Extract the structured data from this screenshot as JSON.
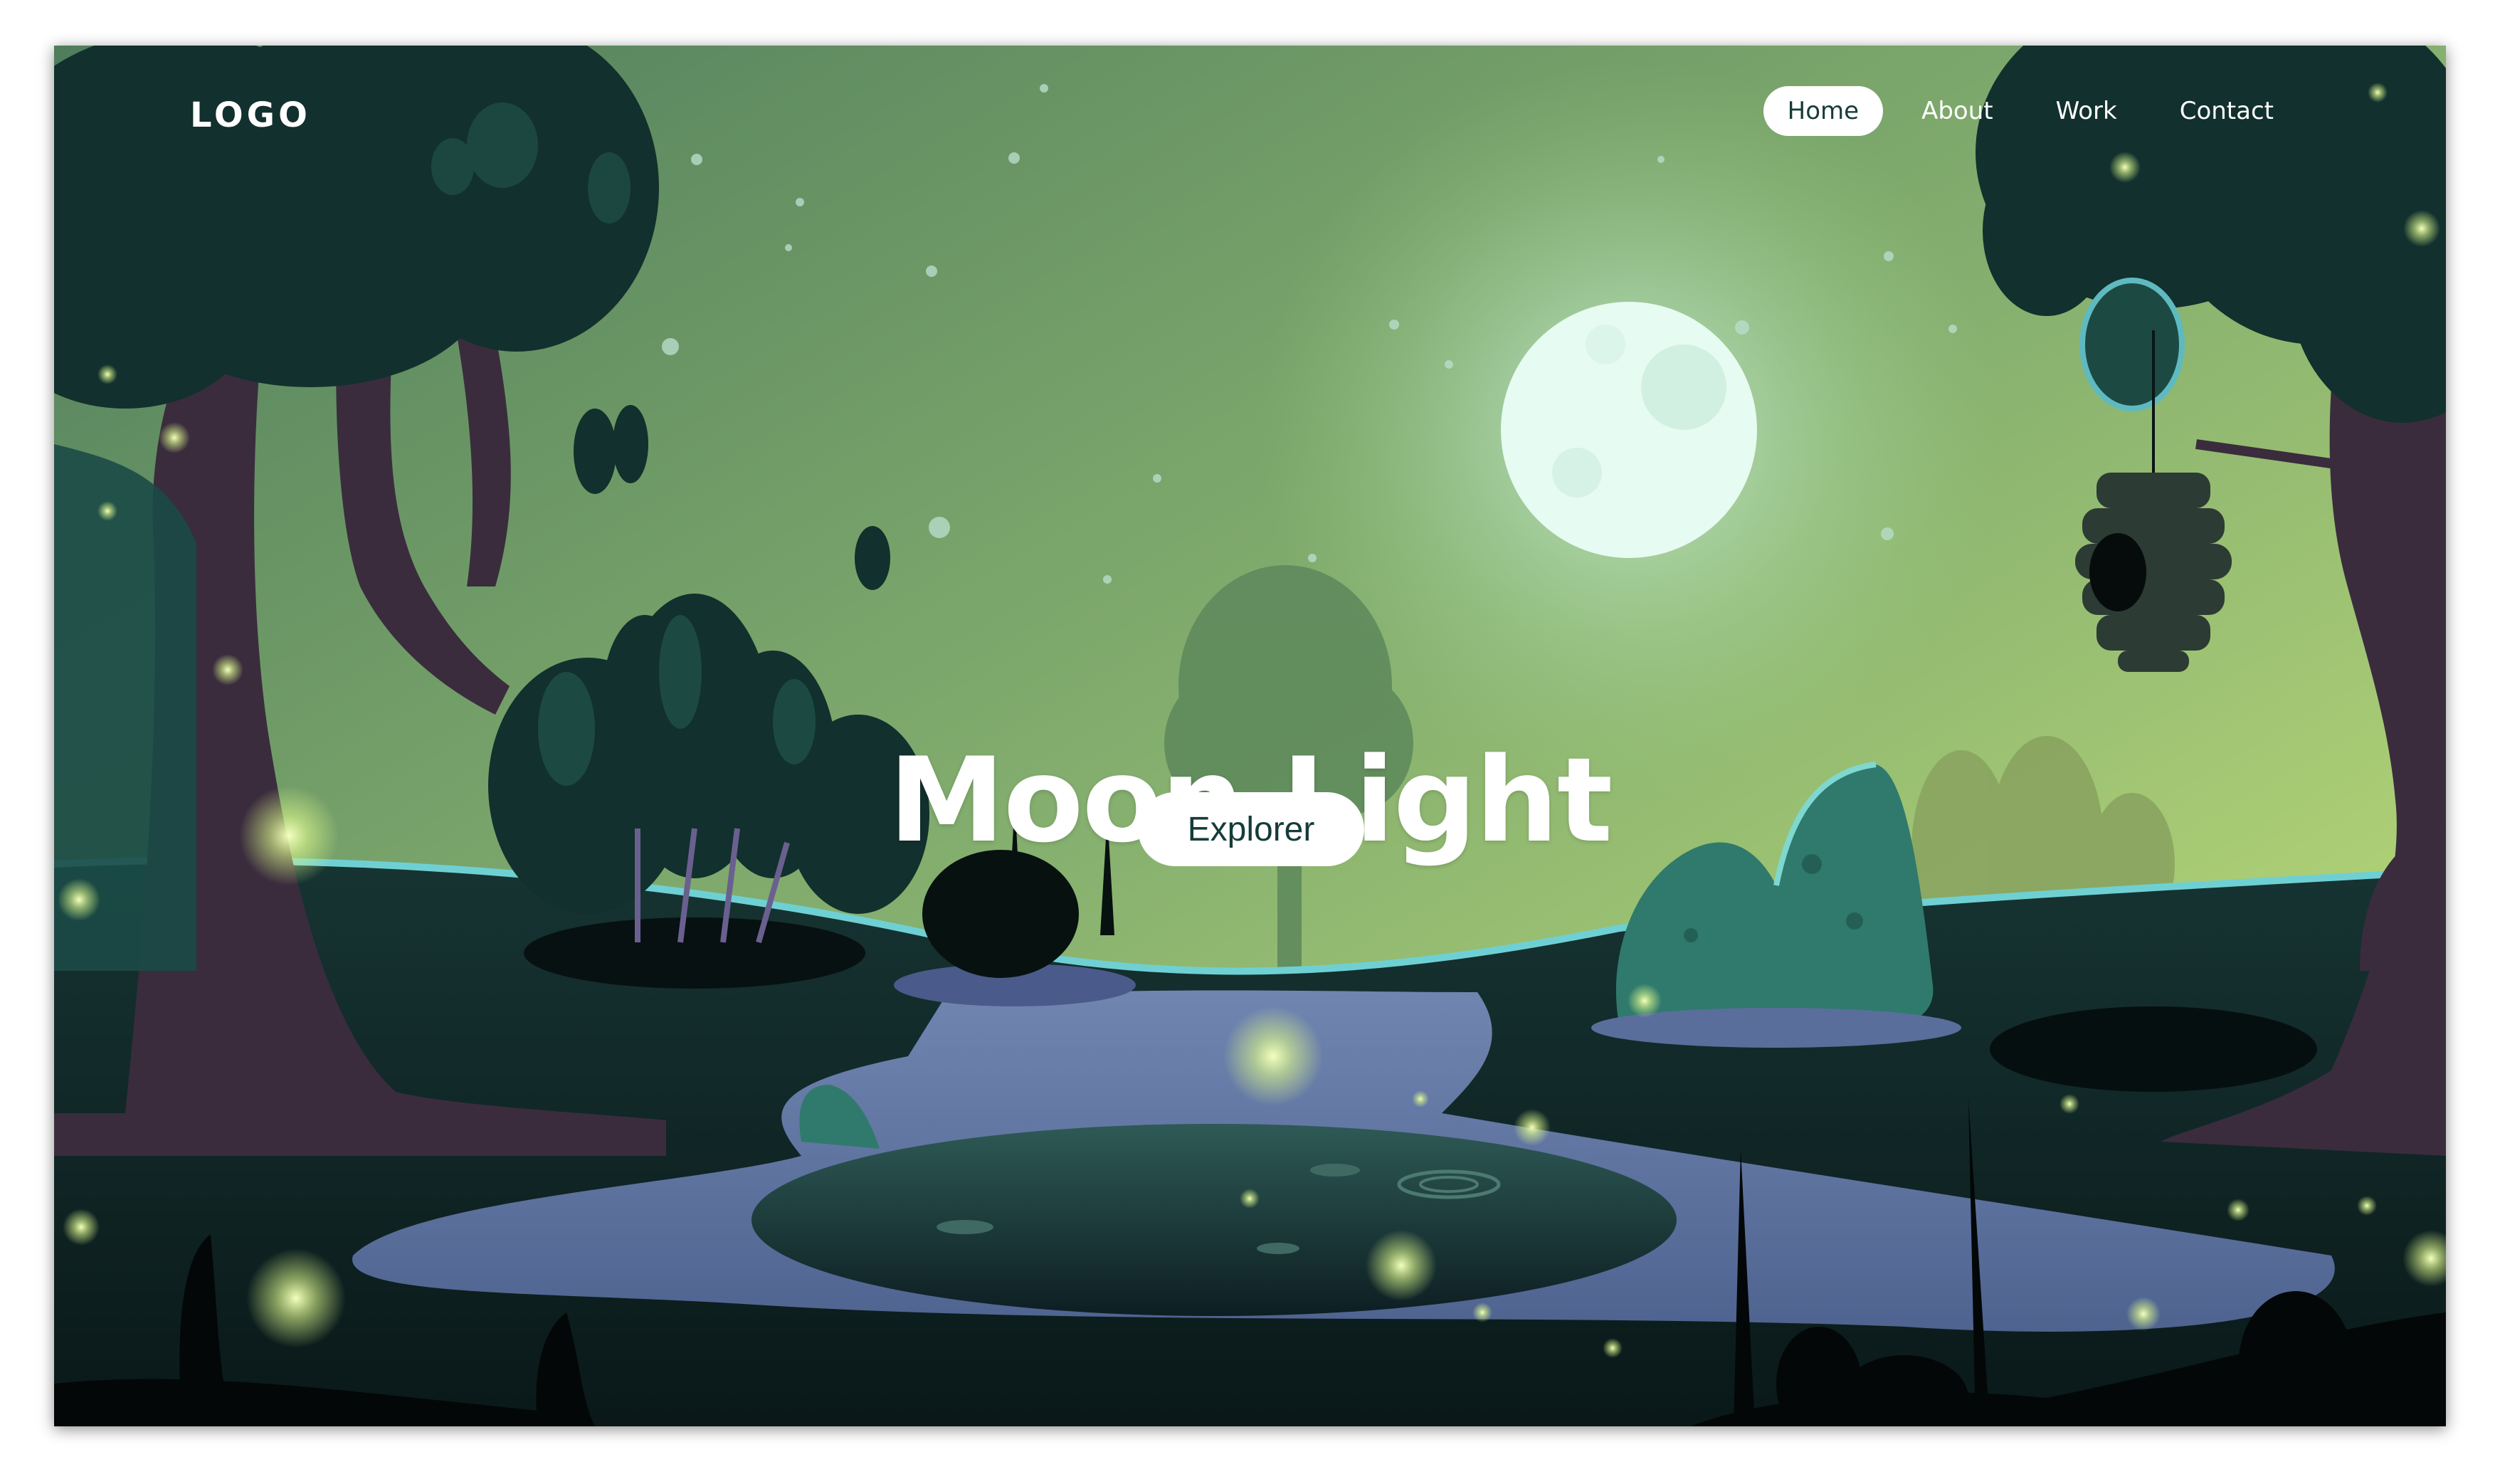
{
  "brand": {
    "logo_text": "LOGO"
  },
  "nav": {
    "items": [
      {
        "label": "Home",
        "active": true
      },
      {
        "label": "About",
        "active": false
      },
      {
        "label": "Work",
        "active": false
      },
      {
        "label": "Contact",
        "active": false
      }
    ]
  },
  "hero": {
    "title": "Moon Light",
    "cta_label": "Explorer"
  },
  "colors": {
    "sky_top": "#5d8a64",
    "sky_bottom": "#c4e07a",
    "moon": "#e8fbf3",
    "ground": "#0f2626",
    "water": "#5a6e9c",
    "firefly": "#d9f58a"
  }
}
